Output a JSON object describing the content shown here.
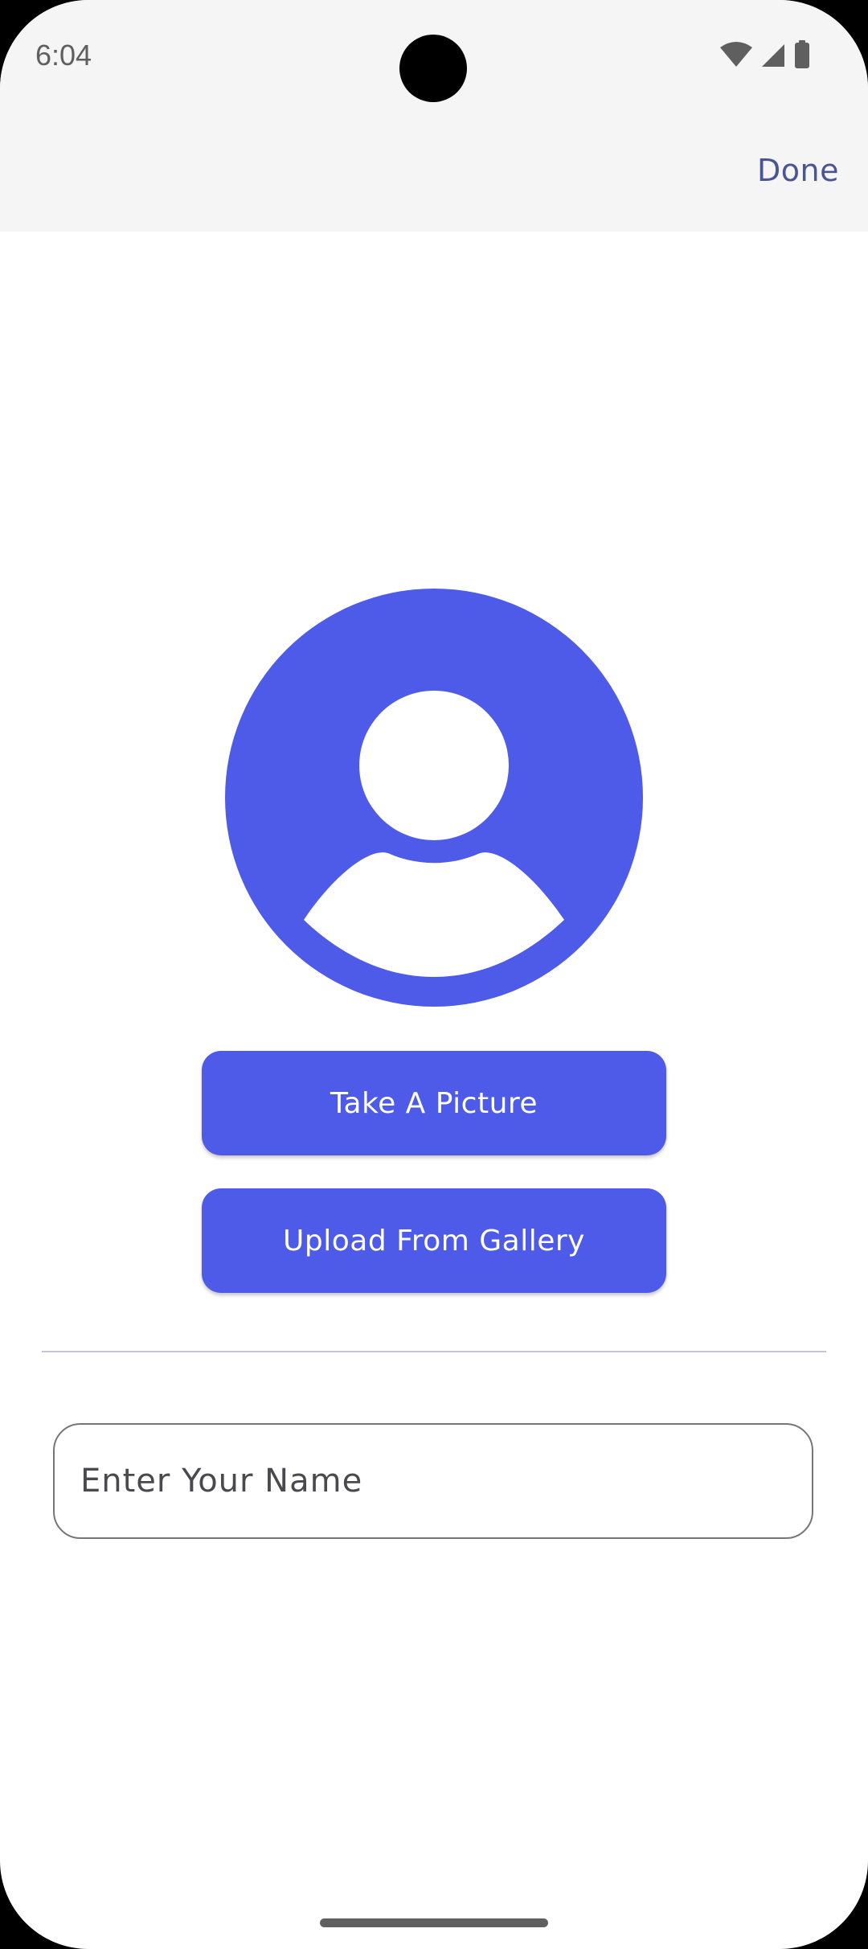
{
  "status_bar": {
    "time": "6:04",
    "icons": [
      "wifi-icon",
      "cell-signal-icon",
      "battery-icon"
    ]
  },
  "app_bar": {
    "done_label": "Done"
  },
  "avatar": {
    "icon": "person-avatar-icon",
    "color": "#4e5be8"
  },
  "actions": {
    "take_picture_label": "Take A Picture",
    "upload_label": "Upload From Gallery"
  },
  "name_input": {
    "placeholder": "Enter Your Name",
    "value": ""
  },
  "colors": {
    "accent": "#4e5be8",
    "done_text": "#4b5592",
    "app_bar_bg": "#f5f5f5"
  }
}
